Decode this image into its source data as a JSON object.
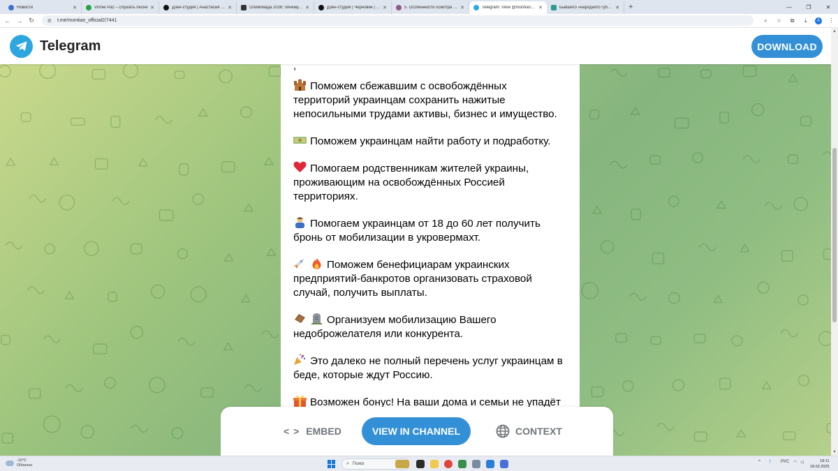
{
  "browser": {
    "tabs": [
      {
        "title": "Новости",
        "color": "#3a6fd8",
        "active": false
      },
      {
        "title": "Vinnie Paz – слушать песни",
        "color": "#25a244",
        "active": false
      },
      {
        "title": "Дзен-студия | Анастасия Мир",
        "color": "#111111",
        "active": false
      },
      {
        "title": "Олимпиада 2026: почему рос",
        "color": "#333333",
        "active": false
      },
      {
        "title": "Дзен-студия | Черновик | Дзен",
        "color": "#111111",
        "active": false
      },
      {
        "title": "5. Особенности осмотра лиц",
        "color": "#8e5a8a",
        "active": false
      },
      {
        "title": "Telegram: View @montian_offi",
        "color": "#2ea6e0",
        "active": true
      },
      {
        "title": "Бывшего «народного губерн",
        "color": "#2a9d8f",
        "active": false
      }
    ],
    "new_tab": "+",
    "url": "t.me/montian_official2/7441",
    "profile_letter": "A"
  },
  "telegram": {
    "brand": "Telegram",
    "download": "DOWNLOAD"
  },
  "message": {
    "lines": [
      {
        "emoji": "castle-emoji",
        "text": [
          "Поможем сбежавшим с освобождённых",
          "территорий украинцам сохранить нажитые",
          "непосильными трудами активы, бизнес и имущество."
        ]
      },
      {
        "emoji": "money-emoji",
        "text": [
          "Поможем украинцам найти работу и подработку."
        ]
      },
      {
        "emoji": "heart-emoji",
        "text": [
          "Помогаем родственникам жителей украины,",
          "проживающим на освобождённых Россией",
          "территориях."
        ]
      },
      {
        "emoji": "person-emoji",
        "text": [
          "Помогаем украинцам от 18 до 60 лет получить",
          "бронь от мобилизации в укровермахт."
        ]
      },
      {
        "emoji": "rocket-fire-emoji",
        "text": [
          "Поможем бенефициарам украинских",
          "предприятий-банкротов организовать страховой",
          "случай, получить выплаты."
        ]
      },
      {
        "emoji": "coffin-headstone-emoji",
        "text": [
          "Организуем мобилизацию Вашего",
          "недоброжелателя или конкурента."
        ]
      },
      {
        "emoji": "party-emoji",
        "text": [
          "Это далеко не полный перечень услуг украинцам в",
          "беде, которые ждут Россию."
        ]
      },
      {
        "emoji": "gift-emoji",
        "text": [
          "Возможен бонус! На ваши дома и семьи не упадёт"
        ]
      }
    ]
  },
  "actions": {
    "embed": "EMBED",
    "view_in_channel": "VIEW IN CHANNEL",
    "context": "CONTEXT"
  },
  "taskbar": {
    "weather_temp": "-10°C",
    "weather_desc": "Облачно",
    "search_placeholder": "Поиск",
    "language": "РУС",
    "time": "18:11",
    "date": "18.02.2025"
  },
  "colors": {
    "accent": "#3390d6",
    "telegram_blue": "#2ea6e0"
  }
}
